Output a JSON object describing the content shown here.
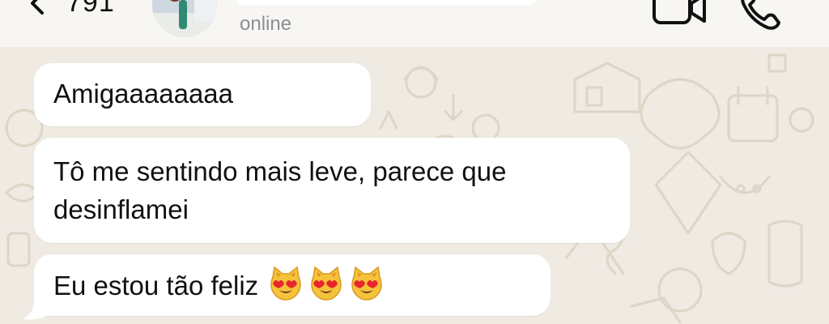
{
  "header": {
    "back_count": "791",
    "status": "online"
  },
  "messages": [
    {
      "text": "Amigaaaaaaaa"
    },
    {
      "text": "Tô me sentindo mais leve, parece que desinflamei"
    },
    {
      "text": "Eu estou tão feliz",
      "emojis": [
        "heart-eyes-cat",
        "heart-eyes-cat",
        "heart-eyes-cat"
      ]
    }
  ],
  "colors": {
    "chat_background": "#efeae2",
    "bubble": "#ffffff",
    "status_text": "#8e8e93"
  }
}
